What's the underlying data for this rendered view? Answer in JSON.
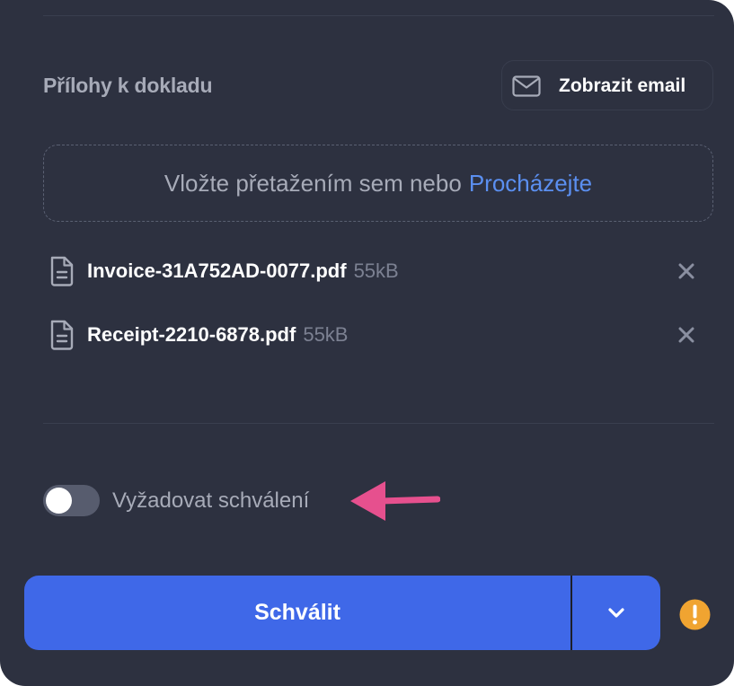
{
  "attachments": {
    "title": "Přílohy k dokladu",
    "show_email_label": "Zobrazit email",
    "dropzone_text": "Vložte přetažením sem nebo",
    "browse_label": "Procházejte",
    "files": [
      {
        "name": "Invoice-31A752AD-0077.pdf",
        "size": "55kB"
      },
      {
        "name": "Receipt-2210-6878.pdf",
        "size": "55kB"
      }
    ]
  },
  "approval": {
    "require_label": "Vyžadovat schválení",
    "require_enabled": false,
    "approve_label": "Schválit"
  },
  "icons": {
    "email": "envelope-icon",
    "file": "document-icon",
    "remove": "close-icon",
    "dropdown": "chevron-down-icon",
    "warning": "warning-icon",
    "annotation": "arrow-left-icon"
  },
  "colors": {
    "panel_bg": "#2d3140",
    "accent": "#3f68e8",
    "link": "#5b8ff0",
    "warning": "#f0a431",
    "annotation_arrow": "#e6508e"
  }
}
